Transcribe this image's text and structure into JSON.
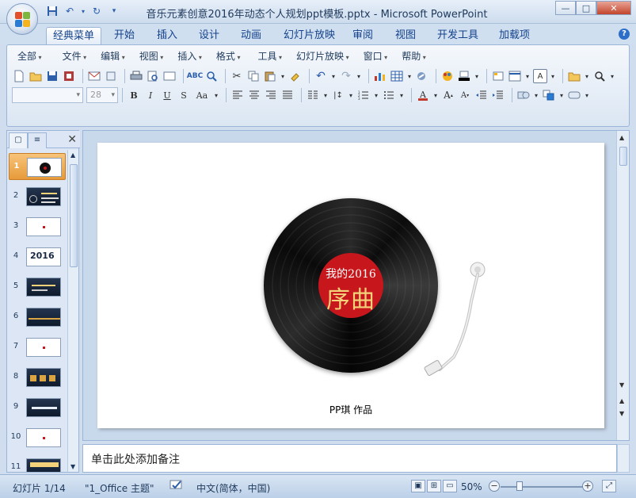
{
  "window": {
    "title": "音乐元素创意2016年动态个人规划ppt模板.pptx - Microsoft PowerPoint",
    "min_label": "—",
    "max_label": "□",
    "close_label": "✕"
  },
  "tabs": [
    "经典菜单",
    "开始",
    "插入",
    "设计",
    "动画",
    "幻灯片放映",
    "审阅",
    "视图",
    "开发工具",
    "加载项"
  ],
  "active_tab": "经典菜单",
  "menu": [
    "全部",
    "文件",
    "编辑",
    "视图",
    "插入",
    "格式",
    "工具",
    "幻灯片放映",
    "窗口",
    "帮助"
  ],
  "format": {
    "font_name": "",
    "font_size": "28",
    "bold": "B",
    "italic": "I",
    "underline": "U",
    "strike": "S",
    "case": "Aa"
  },
  "slides_panel": {
    "thumbnails": [
      {
        "num": "1"
      },
      {
        "num": "2"
      },
      {
        "num": "3"
      },
      {
        "num": "4"
      },
      {
        "num": "5"
      },
      {
        "num": "6"
      },
      {
        "num": "7"
      },
      {
        "num": "8"
      },
      {
        "num": "9"
      },
      {
        "num": "10"
      },
      {
        "num": "11"
      }
    ],
    "selected": "1",
    "thumb4_text": "2016"
  },
  "slide": {
    "label_small": "我的2016",
    "label_big": "序曲",
    "credit": "PP琪 作品"
  },
  "notes": {
    "placeholder": "单击此处添加备注"
  },
  "status": {
    "slide_info": "幻灯片 1/14",
    "theme": "\"1_Office 主题\"",
    "language": "中文(简体，中国)",
    "zoom": "50%"
  },
  "colors": {
    "record_label": "#c8171c",
    "label_big_text": "#f3d27a",
    "selected_thumb": "#e79a3a"
  }
}
